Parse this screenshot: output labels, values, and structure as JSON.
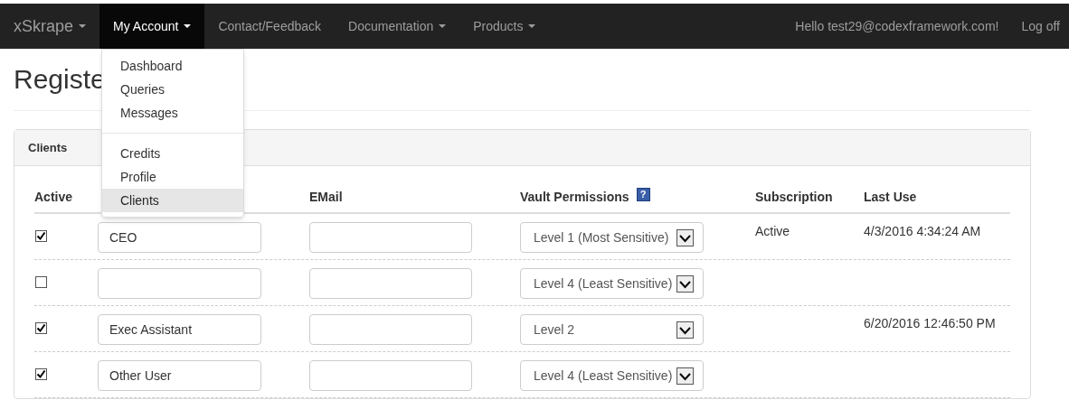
{
  "navbar": {
    "brand": {
      "label": "xSkrape",
      "dropdown": true
    },
    "items": [
      {
        "label": "My Account",
        "dropdown": true,
        "selected": true
      },
      {
        "label": "Contact/Feedback",
        "dropdown": false,
        "selected": false
      },
      {
        "label": "Documentation",
        "dropdown": true,
        "selected": false
      },
      {
        "label": "Products",
        "dropdown": true,
        "selected": false
      }
    ],
    "greeting": "Hello test29@codexframework.com!",
    "logoff": "Log off"
  },
  "account_menu": {
    "groups": [
      [
        {
          "label": "Dashboard",
          "selected": false
        },
        {
          "label": "Queries",
          "selected": false
        },
        {
          "label": "Messages",
          "selected": false
        }
      ],
      [
        {
          "label": "Credits",
          "selected": false
        },
        {
          "label": "Profile",
          "selected": false
        },
        {
          "label": "Clients",
          "selected": true
        }
      ]
    ]
  },
  "page_title": "Registe",
  "panel": {
    "title": "Clients",
    "columns": [
      {
        "label": "Active"
      },
      {},
      {
        "label": "EMail"
      },
      {
        "label": "Vault Permissions",
        "help": "?"
      },
      {
        "label": "Subscription"
      },
      {
        "label": "Last Use"
      }
    ],
    "rows": [
      {
        "checked": true,
        "name": "CEO",
        "permission": "Level 1 (Most Sensitive)",
        "subscription": "Active",
        "last_use": "4/3/2016 4:34:24 AM"
      },
      {
        "checked": false,
        "name": "",
        "permission": "Level 4 (Least Sensitive)"
      },
      {
        "checked": true,
        "name": "Exec Assistant",
        "permission": "Level 2",
        "last_use": "6/20/2016 12:46:50 PM"
      },
      {
        "checked": true,
        "name": "Other User",
        "permission": "Level 4 (Least Sensitive)"
      }
    ]
  }
}
